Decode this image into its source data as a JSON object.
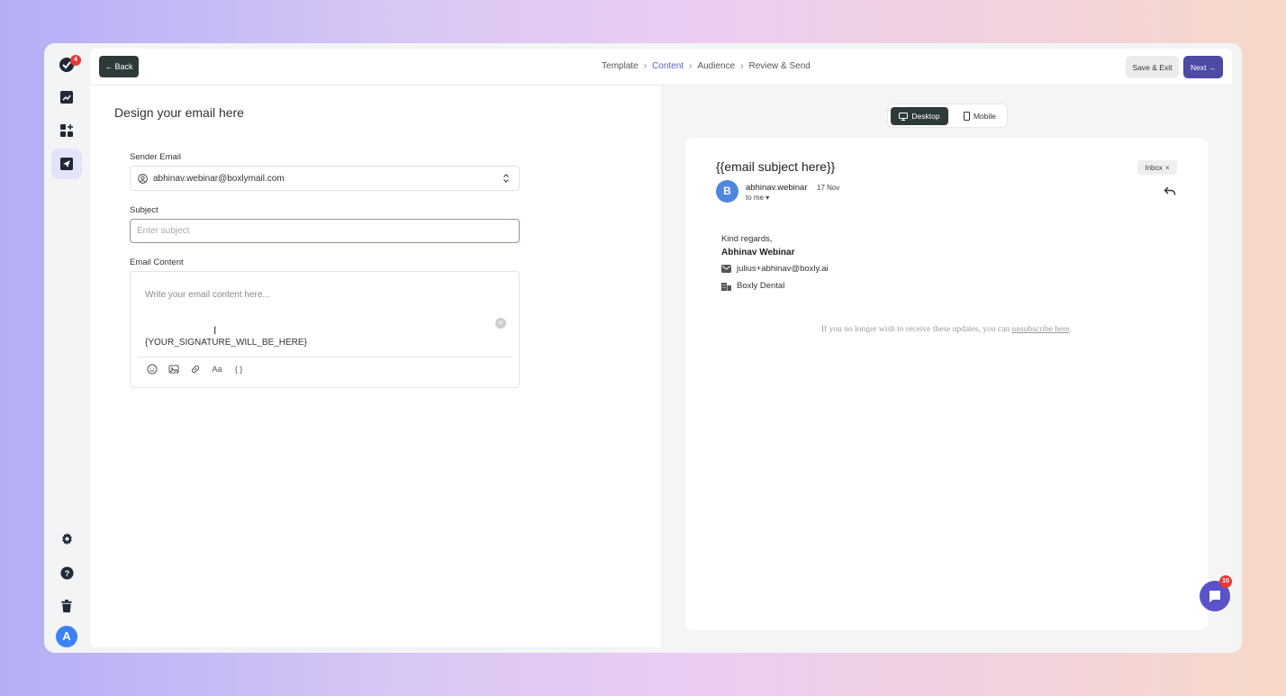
{
  "sidebar": {
    "logo_badge": "4",
    "user_initial": "A",
    "icons": [
      "logo-icon",
      "analytics-icon",
      "apps-add-icon",
      "send-icon",
      "settings-icon",
      "help-icon",
      "trash-icon"
    ]
  },
  "topbar": {
    "back_label": "Back",
    "steps": [
      "Template",
      "Content",
      "Audience",
      "Review & Send"
    ],
    "active_step": "Content",
    "save_exit_label": "Save & Exit",
    "next_label": "Next"
  },
  "form": {
    "title": "Design your email here",
    "sender_label": "Sender Email",
    "sender_value": "abhinav.webinar@boxlymail.com",
    "subject_label": "Subject",
    "subject_placeholder": "Enter subject",
    "content_label": "Email Content",
    "content_placeholder": "Write your email content here...",
    "signature_placeholder": "{YOUR_SIGNATURE_WILL_BE_HERE}",
    "text_tool_label": "Aa",
    "variable_tool_label": "{ }"
  },
  "preview": {
    "desktop_label": "Desktop",
    "mobile_label": "Mobile",
    "subject": "{{email subject here}}",
    "inbox_label": "Inbox",
    "sender_initial": "B",
    "sender_name": "abhinav.webinar",
    "date": "17 Nov",
    "to_me": "to me",
    "regards": "Kind regards,",
    "signature_name": "Abhinav Webinar",
    "signature_email": "julius+abhinav@boxly.ai",
    "signature_company": "Boxly Dental",
    "unsubscribe_text": "If you no longer wish to receive these updates, you can",
    "unsubscribe_link": "unsubscribe here",
    "unsubscribe_end": "."
  },
  "chat": {
    "badge": "10"
  },
  "colors": {
    "accent": "#4c4aa3",
    "dark_button": "#2d3a3a",
    "active_step": "#5b5fc7"
  }
}
